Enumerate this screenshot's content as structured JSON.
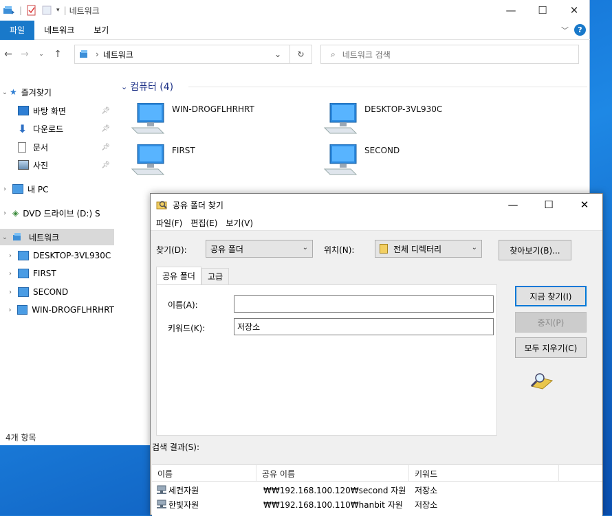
{
  "explorer": {
    "title": "네트워크",
    "ribbon": {
      "file": "파일",
      "network": "네트워크",
      "view": "보기"
    },
    "address": {
      "location": "네트워크"
    },
    "search": {
      "placeholder": "네트워크 검색"
    },
    "nav": {
      "quick_access": "즐겨찾기",
      "desktop": "바탕 화면",
      "downloads": "다운로드",
      "documents": "문서",
      "pictures": "사진",
      "this_pc": "내 PC",
      "dvd": "DVD 드라이브 (D:) S",
      "network": "네트워크",
      "net_items": [
        "DESKTOP-3VL930C",
        "FIRST",
        "SECOND",
        "WIN-DROGFLHRHRT"
      ]
    },
    "group_header": "컴퓨터 (4)",
    "computers": [
      "WIN-DROGFLHRHRT",
      "DESKTOP-3VL930C",
      "FIRST",
      "SECOND"
    ],
    "status": "4개 항목"
  },
  "dialog": {
    "title": "공유 폴더 찾기",
    "menu": {
      "file": "파일(F)",
      "edit": "편집(E)",
      "view": "보기(V)"
    },
    "find_label": "찾기(D):",
    "find_value": "공유 폴더",
    "location_label": "위치(N):",
    "location_value": "전체 디렉터리",
    "browse": "찾아보기(B)...",
    "tabs": {
      "shared": "공유 폴더",
      "advanced": "고급"
    },
    "name_label": "이름(A):",
    "name_value": "",
    "keyword_label": "키워드(K):",
    "keyword_value": "저장소",
    "find_now": "지금 찾기(I)",
    "stop": "중지(P)",
    "clear_all": "모두 지우기(C)",
    "results_label": "검색 결과(S):",
    "columns": {
      "name": "이름",
      "share_name": "공유 이름",
      "keyword": "키워드"
    },
    "results": [
      {
        "name": "세컨자원",
        "share": "₩₩192.168.100.120₩second 자원",
        "keyword": "저장소"
      },
      {
        "name": "한빛자원",
        "share": "₩₩192.168.100.110₩hanbit 자원",
        "keyword": "저장소"
      }
    ]
  },
  "colors": {
    "accent": "#1979ca",
    "desktop": "#1a78d4",
    "header": "#1e3287"
  }
}
